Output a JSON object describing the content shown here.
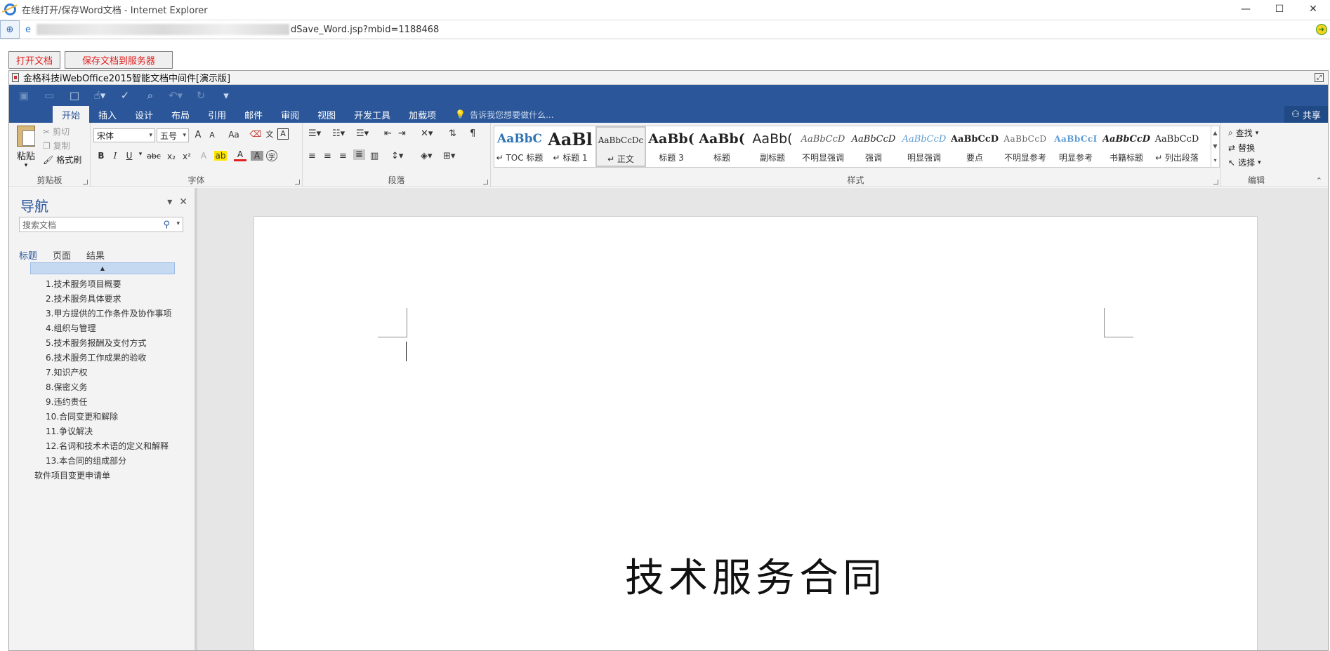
{
  "window": {
    "title": "在线打开/保存Word文档 - Internet Explorer",
    "controls": {
      "minimize": "—",
      "maximize": "☐",
      "close": "✕"
    }
  },
  "addressbar": {
    "url_visible": "dSave_Word.jsp?mbid=1188468"
  },
  "page_buttons": {
    "open": "打开文档",
    "save": "保存文档到服务器"
  },
  "plugin": {
    "title": "金格科技iWebOffice2015智能文档中间件[演示版]"
  },
  "ribbon": {
    "tabs": [
      "开始",
      "插入",
      "设计",
      "布局",
      "引用",
      "邮件",
      "审阅",
      "视图",
      "开发工具",
      "加载项"
    ],
    "tell_me": "告诉我您想要做什么...",
    "share": "共享",
    "clipboard": {
      "paste": "粘贴",
      "cut": "剪切",
      "copy": "复制",
      "format_painter": "格式刷",
      "label": "剪贴板"
    },
    "font": {
      "name": "宋体",
      "size": "五号",
      "grow": "A",
      "shrink": "A",
      "case": "Aa",
      "bold": "B",
      "italic": "I",
      "underline": "U",
      "strike": "abc",
      "sub": "x₂",
      "sup": "x²",
      "label": "字体"
    },
    "paragraph": {
      "label": "段落"
    },
    "styles": {
      "label": "样式",
      "items": [
        {
          "sample": "AaBbC",
          "name": "↵ TOC 标题"
        },
        {
          "sample": "AaBl",
          "name": "↵ 标题 1"
        },
        {
          "sample": "AaBbCcDc",
          "name": "↵ 正文"
        },
        {
          "sample": "AaBb(",
          "name": "标题 3"
        },
        {
          "sample": "AaBb(",
          "name": "标题"
        },
        {
          "sample": "AaBb(",
          "name": "副标题"
        },
        {
          "sample": "AaBbCcD",
          "name": "不明显强调"
        },
        {
          "sample": "AaBbCcD",
          "name": "强调"
        },
        {
          "sample": "AaBbCcD",
          "name": "明显强调"
        },
        {
          "sample": "AaBbCcD",
          "name": "要点"
        },
        {
          "sample": "AaBbCcD",
          "name": "不明显参考"
        },
        {
          "sample": "AaBbCcI",
          "name": "明显参考"
        },
        {
          "sample": "AaBbCcD",
          "name": "书籍标题"
        },
        {
          "sample": "AaBbCcD",
          "name": "↵ 列出段落"
        }
      ]
    },
    "editing": {
      "find": "查找",
      "replace": "替换",
      "select": "选择",
      "label": "编辑"
    }
  },
  "navigation": {
    "title": "导航",
    "search_placeholder": "搜索文档",
    "tabs": [
      "标题",
      "页面",
      "结果"
    ],
    "headings": [
      {
        "text": "1.技术服务项目概要",
        "level": 2
      },
      {
        "text": "2.技术服务具体要求",
        "level": 2
      },
      {
        "text": "3.甲方提供的工作条件及协作事项",
        "level": 2
      },
      {
        "text": "4.组织与管理",
        "level": 2
      },
      {
        "text": "5.技术服务报酬及支付方式",
        "level": 2
      },
      {
        "text": "6.技术服务工作成果的验收",
        "level": 2
      },
      {
        "text": "7.知识产权",
        "level": 2
      },
      {
        "text": "8.保密义务",
        "level": 2
      },
      {
        "text": "9.违约责任",
        "level": 2
      },
      {
        "text": "10.合同变更和解除",
        "level": 2
      },
      {
        "text": "11.争议解决",
        "level": 2
      },
      {
        "text": "12.名词和技术术语的定义和解释",
        "level": 2
      },
      {
        "text": "13.本合同的组成部分",
        "level": 2
      },
      {
        "text": "软件项目变更申请单",
        "level": 1
      }
    ]
  },
  "document": {
    "heading": "技术服务合同"
  },
  "colors": {
    "word_blue": "#2b579a",
    "button_red": "#e31e1e"
  }
}
